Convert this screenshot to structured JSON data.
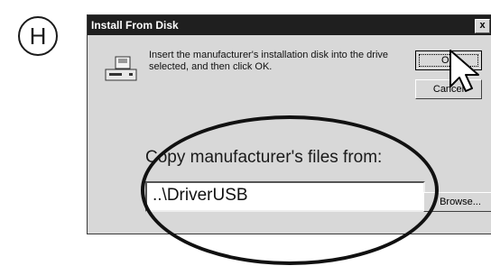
{
  "step": {
    "letter": "H"
  },
  "dialog": {
    "title": "Install From Disk",
    "close_glyph": "x",
    "icon": "disk-drive-icon",
    "message": "Insert the manufacturer's installation disk into the drive selected, and then click OK.",
    "buttons": {
      "ok": "OK",
      "cancel": "Cancel",
      "browse": "Browse..."
    },
    "copy_label": "Copy manufacturer's files from:",
    "path_value": "..\\DriverUSB"
  },
  "overlay": {
    "highlight": "ellipse-highlight",
    "pointer": "arrow-cursor-icon"
  },
  "colors": {
    "titlebar": "#1f1f1f",
    "dialog_bg": "#d8d8d8",
    "field_bg": "#ffffff"
  }
}
